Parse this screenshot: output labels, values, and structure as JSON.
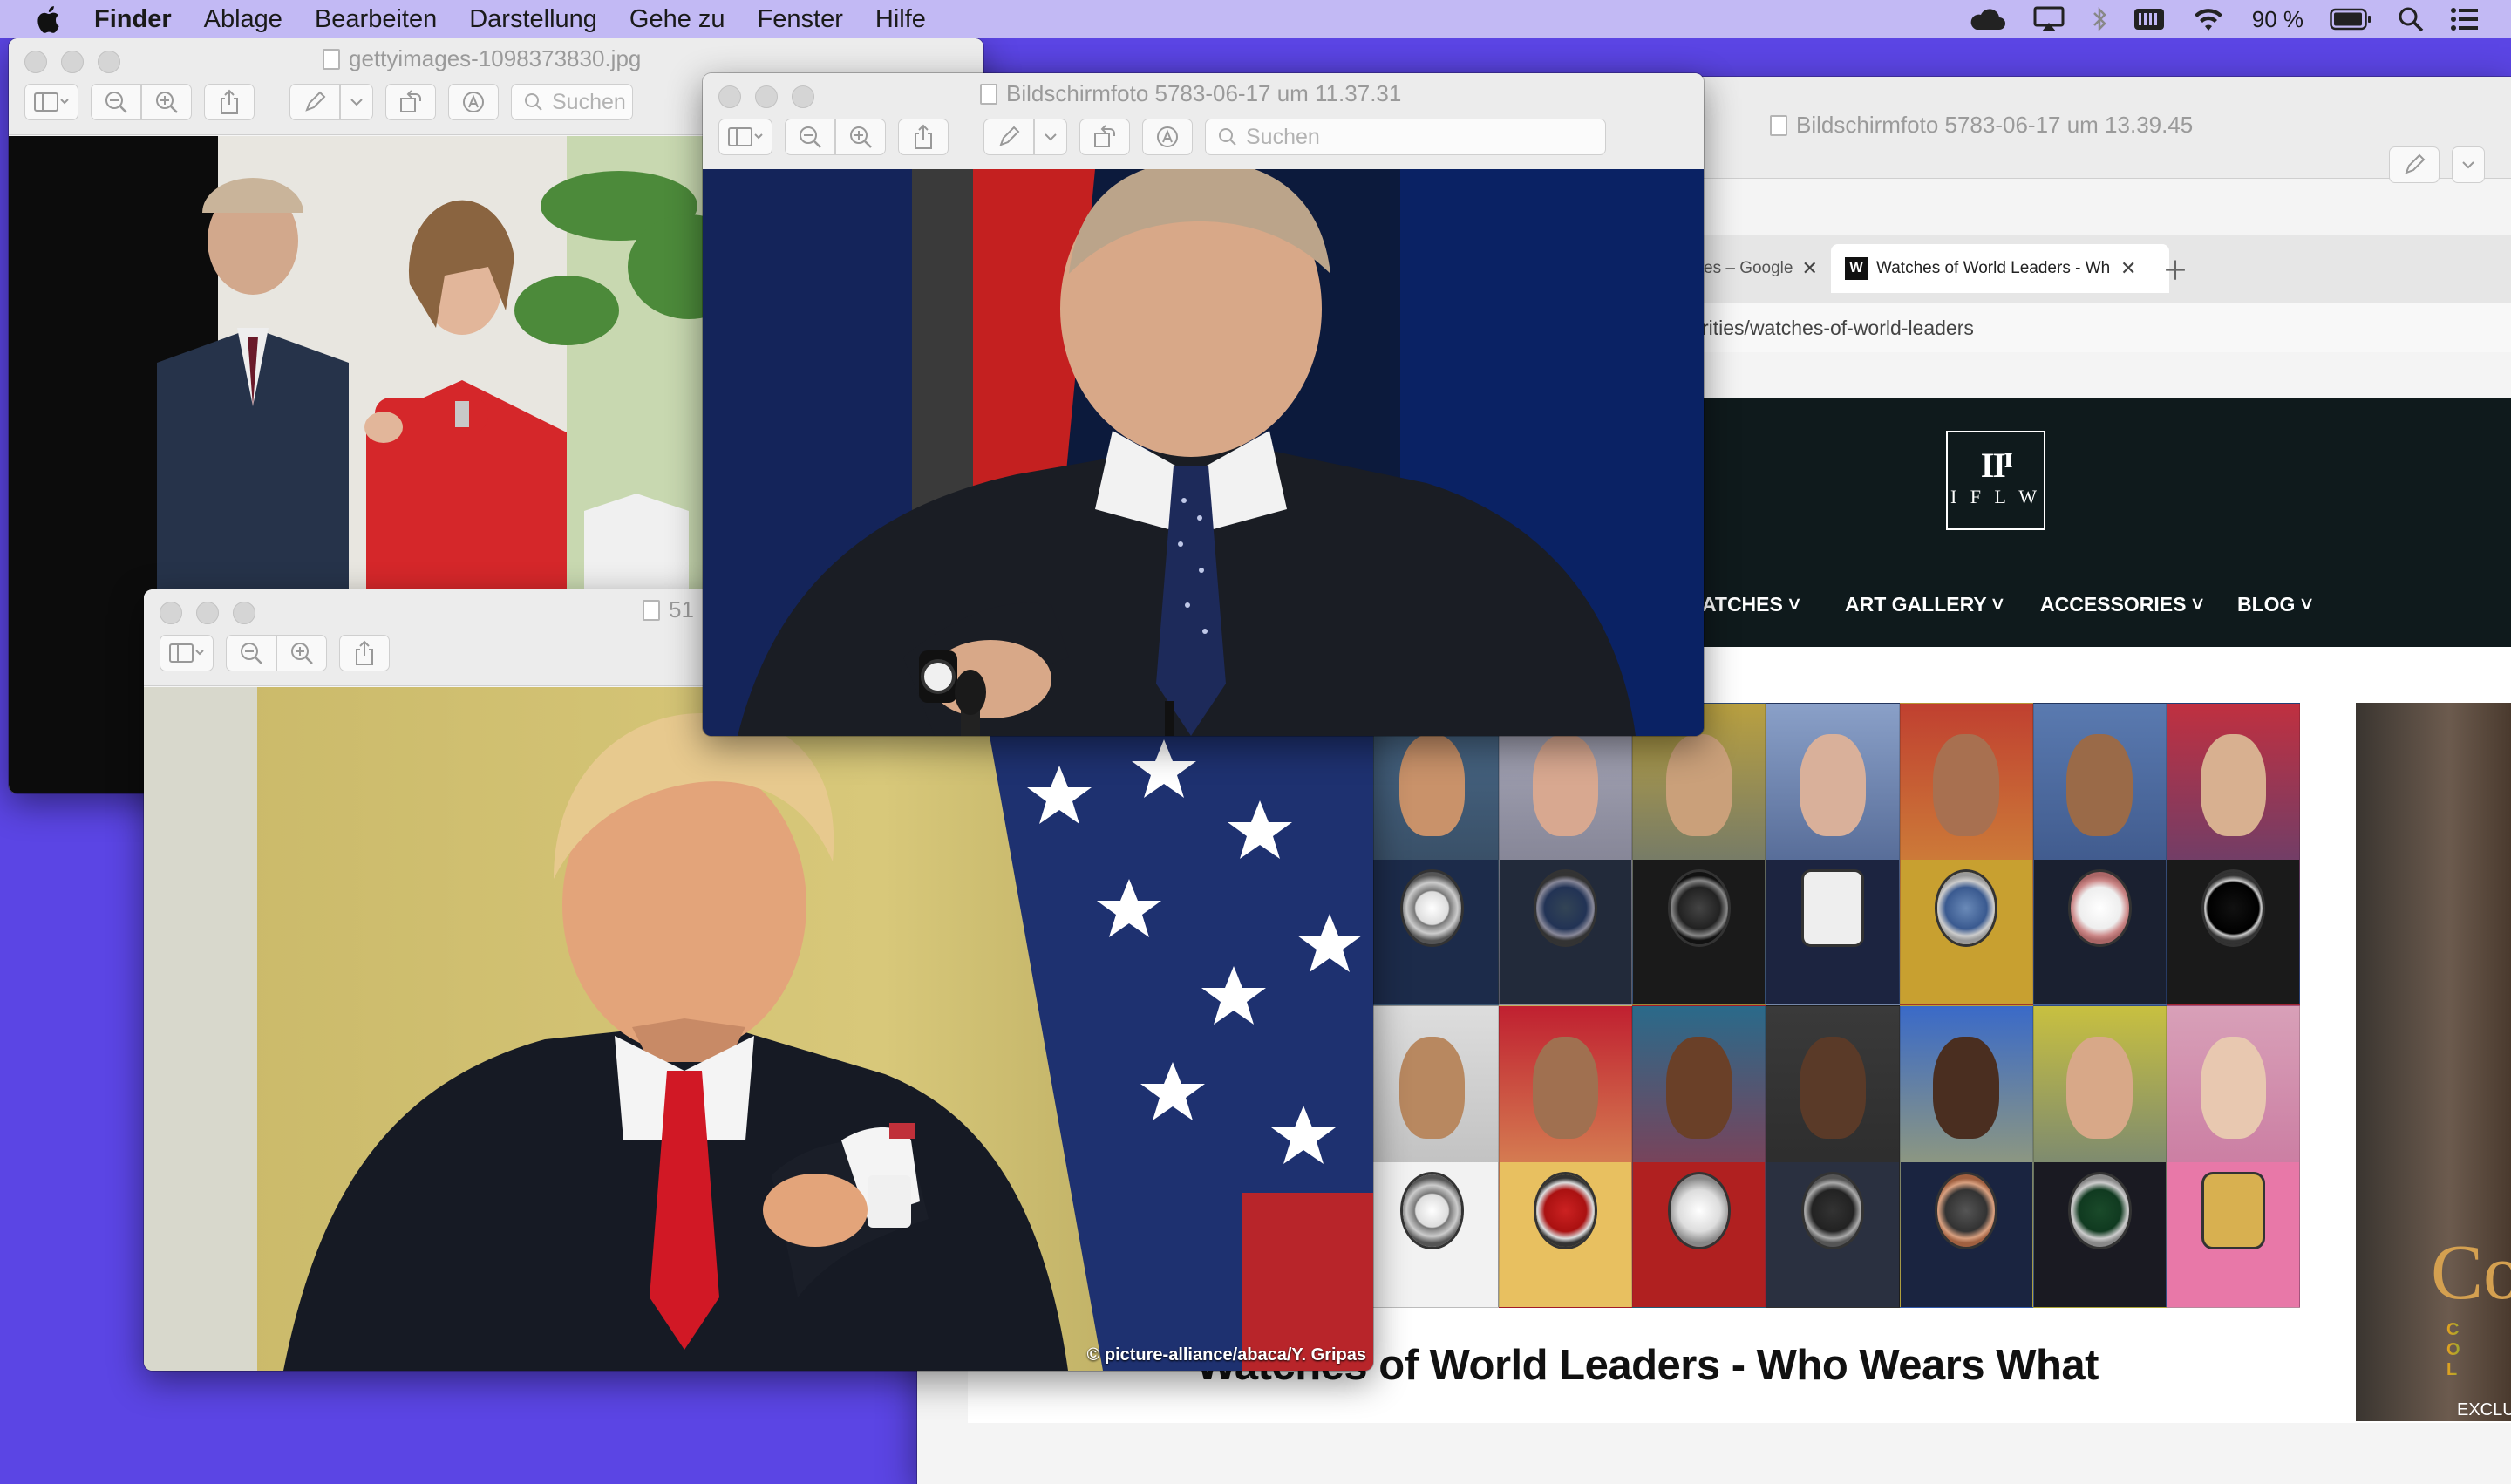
{
  "menubar": {
    "app": "Finder",
    "items": [
      "Ablage",
      "Bearbeiten",
      "Darstellung",
      "Gehe zu",
      "Fenster",
      "Hilfe"
    ],
    "battery_pct": "90 %"
  },
  "windows": {
    "getty": {
      "title": "gettyimages-1098373830.jpg",
      "search_placeholder": "Suchen"
    },
    "putin": {
      "title": "Bildschirmfoto 5783-06-17 um 11.37.31",
      "search_placeholder": "Suchen"
    },
    "trump": {
      "title": "51",
      "photo_credit": "© picture-alliance/abaca/Y. Gripas"
    },
    "browser": {
      "title": "Bildschirmfoto 5783-06-17 um 13.39.45",
      "tabs": [
        {
          "label": "es – Google"
        },
        {
          "label": "Watches of World Leaders - Wh"
        }
      ],
      "url": "rities/watches-of-world-leaders",
      "site": {
        "logo_mark": "IIᴵ",
        "logo_text": "I F L W",
        "nav": [
          "ATCHES",
          "ART GALLERY",
          "ACCESSORIES",
          "BLOG"
        ],
        "headline": "Watches of World Leaders - Who Wears What",
        "side_text": "Co",
        "side_colo": "C O L",
        "side_excl": "EXCLU"
      }
    }
  },
  "colors": {
    "desktop": "#5b45e4",
    "menubar": "#c2b9f4",
    "site_header": "#0f1a1c"
  }
}
